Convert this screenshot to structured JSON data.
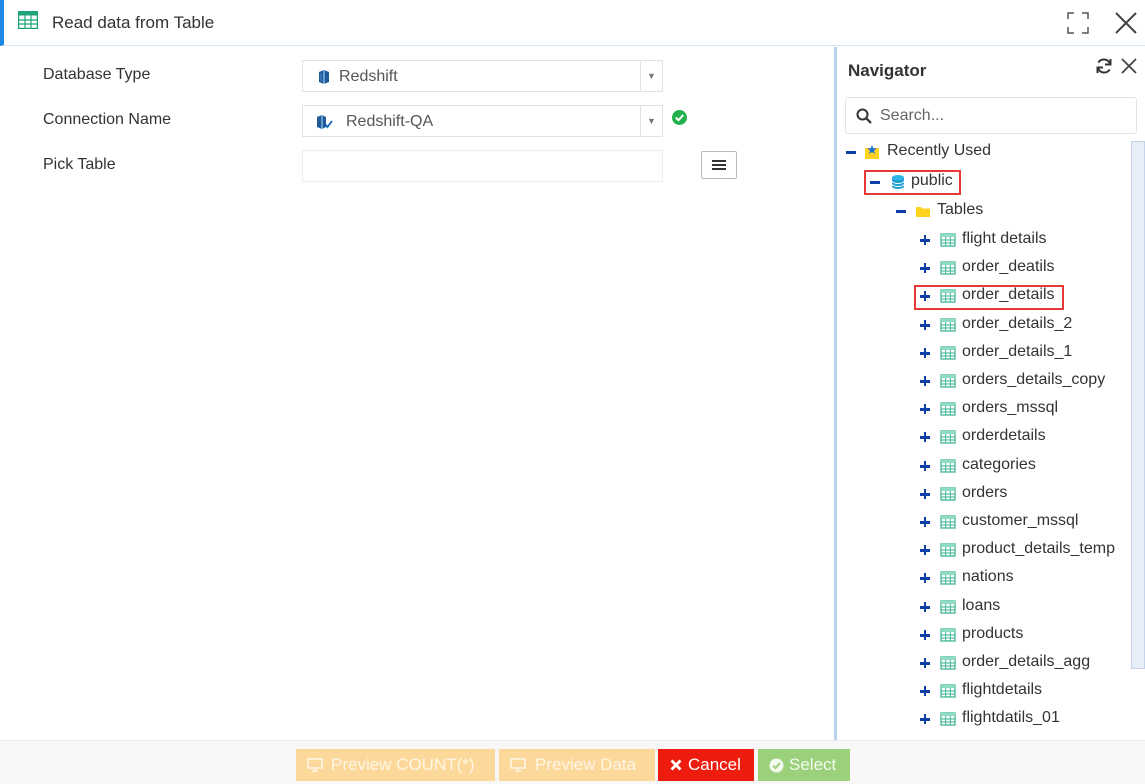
{
  "window": {
    "title": "Read data from Table"
  },
  "form": {
    "database_type": {
      "label": "Database Type",
      "value": "Redshift"
    },
    "connection_name": {
      "label": "Connection Name",
      "value": "Redshift-QA",
      "status": "connected"
    },
    "pick_table": {
      "label": "Pick Table",
      "value": ""
    }
  },
  "navigator": {
    "title": "Navigator",
    "search_placeholder": "Search...",
    "tree": {
      "recently_used": "Recently Used",
      "schema": "public",
      "folder": "Tables",
      "tables": [
        "flight details",
        "order_deatils",
        "order_details",
        "order_details_2",
        "order_details_1",
        "orders_details_copy",
        "orders_mssql",
        "orderdetails",
        "categories",
        "orders",
        "customer_mssql",
        "product_details_temp",
        "nations",
        "loans",
        "products",
        "order_details_agg",
        "flightdetails",
        "flightdatils_01"
      ],
      "highlighted": [
        "public",
        "order_details"
      ]
    }
  },
  "footer": {
    "preview_count": "Preview COUNT(*)",
    "preview_data": "Preview Data",
    "cancel": "Cancel",
    "select": "Select"
  },
  "colors": {
    "accent": "#1e88e5",
    "tree_toggle": "#0d3fa6",
    "highlight": "#e53935",
    "cancel": "#ee1c0e",
    "select": "#9bd17a",
    "preview": "#fcd89a",
    "connected": "#22b14c"
  }
}
